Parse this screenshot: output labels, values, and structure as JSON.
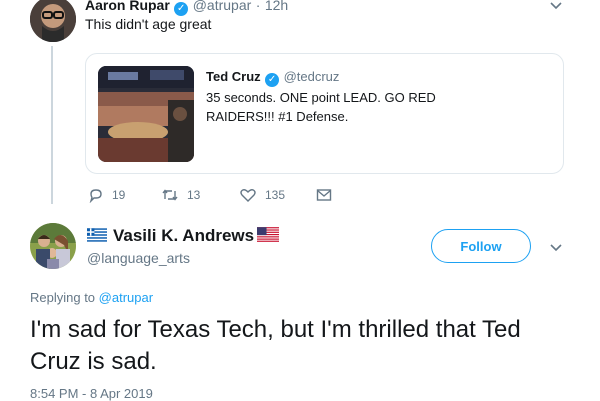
{
  "top_tweet": {
    "author_name": "Aaron Rupar",
    "handle": "@atrupar",
    "separator": "·",
    "time": "12h",
    "text": "This didn't age great",
    "quoted": {
      "author_name": "Ted Cruz",
      "handle": "@tedcruz",
      "text": "35 seconds. ONE point LEAD. GO RED RAIDERS!!! #1 Defense."
    },
    "actions": {
      "replies": "19",
      "retweets": "13",
      "likes": "135"
    }
  },
  "main_tweet": {
    "author_name": "Vasili K. Andrews",
    "handle": "@language_arts",
    "follow_label": "Follow",
    "replying_prefix": "Replying to",
    "replying_to": "@atrupar",
    "text": "I'm sad for Texas Tech, but I'm thrilled that Ted Cruz is sad.",
    "timestamp": "8:54 PM - 8 Apr 2019"
  },
  "colors": {
    "accent": "#1da1f2",
    "muted": "#657786",
    "text": "#14171a",
    "border": "#e1e8ed"
  }
}
